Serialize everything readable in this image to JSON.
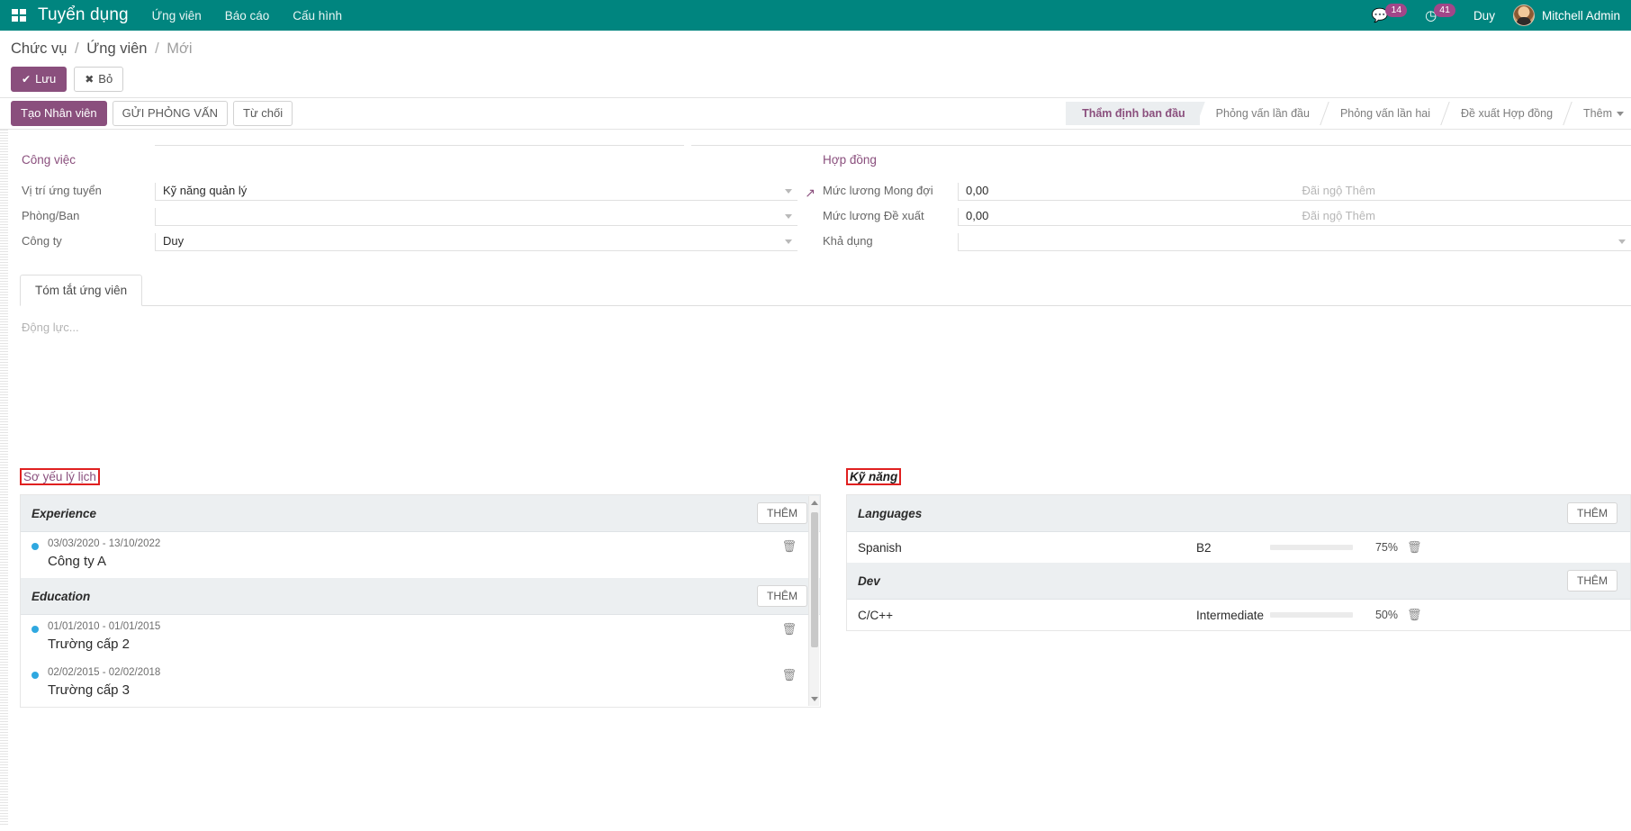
{
  "topbar": {
    "apps_icon": "apps-grid-icon",
    "brand": "Tuyển dụng",
    "menu": [
      {
        "label": "Ứng viên"
      },
      {
        "label": "Báo cáo"
      },
      {
        "label": "Cấu hình"
      }
    ],
    "messages": {
      "icon": "chat-bubble-icon",
      "count": "14"
    },
    "activities": {
      "icon": "clock-icon",
      "count": "41"
    },
    "company": "Duy",
    "user": "Mitchell Admin",
    "accent": "#00857f",
    "badge_color": "#a24689"
  },
  "breadcrumb": {
    "items": [
      "Chức vụ",
      "Ứng viên"
    ],
    "current": "Mới",
    "sep": "/"
  },
  "savebar": {
    "save_label": "Lưu",
    "save_icon": "check-icon",
    "discard_label": "Bỏ",
    "discard_icon": "close-icon"
  },
  "actions": {
    "buttons": [
      {
        "label": "Tạo Nhân viên",
        "highlight": true
      },
      {
        "label": "GỬI PHỎNG VẤN",
        "highlight": false
      },
      {
        "label": "Từ chối",
        "highlight": false
      }
    ]
  },
  "statusbar": {
    "stages": [
      {
        "label": "Thẩm định ban đầu",
        "active": true
      },
      {
        "label": "Phỏng vấn lần đầu",
        "active": false
      },
      {
        "label": "Phỏng vấn lần hai",
        "active": false
      },
      {
        "label": "Đề xuất Hợp đồng",
        "active": false
      },
      {
        "label": "Thêm",
        "active": false,
        "more": true
      }
    ],
    "active_color": "#8a4f7d"
  },
  "form": {
    "left": {
      "group_title": "Công việc",
      "fields": [
        {
          "label": "Vị trí ứng tuyển",
          "value": "Kỹ năng quản lý",
          "dropdown": true,
          "external_link": true,
          "external_icon": "external-link-icon"
        },
        {
          "label": "Phòng/Ban",
          "value": "",
          "dropdown": true,
          "external_link": false
        },
        {
          "label": "Công ty",
          "value": "Duy",
          "dropdown": true,
          "external_link": false
        }
      ]
    },
    "right": {
      "group_title": "Hợp đồng",
      "fields": [
        {
          "label": "Mức lương Mong đợi",
          "value": "0,00",
          "extra_placeholder": "Đãi ngộ Thêm",
          "dropdown": false
        },
        {
          "label": "Mức lương Đề xuất",
          "value": "0,00",
          "extra_placeholder": "Đãi ngộ Thêm",
          "dropdown": false
        },
        {
          "label": "Khả dụng",
          "value": "",
          "extra_placeholder": "",
          "dropdown": true
        }
      ]
    }
  },
  "notebook": {
    "tabs": [
      {
        "label": "Tóm tắt ứng viên",
        "active": true
      }
    ],
    "editor_placeholder": "Động lực..."
  },
  "resume": {
    "section_label": "Sơ yếu lý lịch",
    "annotated": true,
    "groups": [
      {
        "title": "Experience",
        "add_label": "THÊM",
        "lines": [
          {
            "dates": "03/03/2020 - 13/10/2022",
            "title": "Công ty A",
            "delete_icon": "trash-icon"
          }
        ]
      },
      {
        "title": "Education",
        "add_label": "THÊM",
        "lines": [
          {
            "dates": "01/01/2010 - 01/01/2015",
            "title": "Trường cấp 2",
            "delete_icon": "trash-icon"
          },
          {
            "dates": "02/02/2015 - 02/02/2018",
            "title": "Trường cấp 3",
            "delete_icon": "trash-icon"
          }
        ]
      }
    ]
  },
  "skills": {
    "section_label": "Kỹ năng",
    "annotated": true,
    "groups": [
      {
        "title": "Languages",
        "add_label": "THÊM",
        "rows": [
          {
            "name": "Spanish",
            "level": "B2",
            "percent": "75%",
            "progress": 75,
            "delete_icon": "trash-icon"
          }
        ]
      },
      {
        "title": "Dev",
        "add_label": "THÊM",
        "rows": [
          {
            "name": "C/C++",
            "level": "Intermediate",
            "percent": "50%",
            "progress": 50,
            "delete_icon": "trash-icon"
          }
        ]
      }
    ],
    "progress_color": "#7a3f72"
  }
}
